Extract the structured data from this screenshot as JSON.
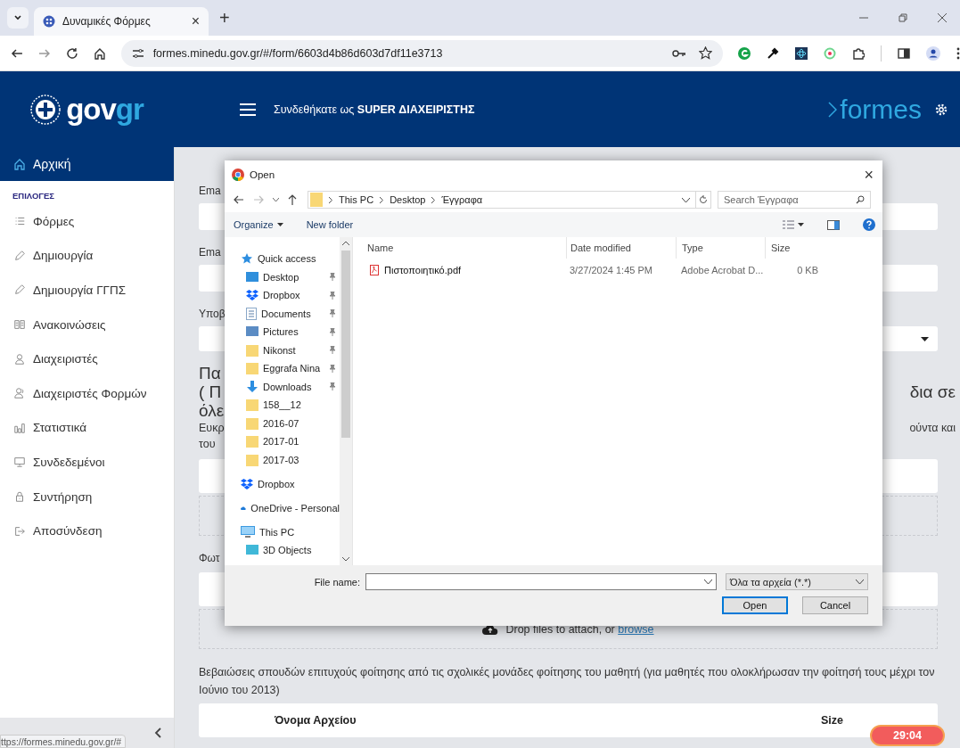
{
  "browser": {
    "tab": {
      "title": "Δυναμικές Φόρμες",
      "close": "×"
    },
    "new_tab": "+",
    "url": "formes.minedu.gov.gr/#/form/6603d4b86d603d7df11e3713",
    "status_url": "ttps://formes.minedu.gov.gr/#"
  },
  "header": {
    "logo": {
      "part_1": "gov",
      "part_2": "gr"
    },
    "login_text": "Συνδεθήκατε ως **SUPER ΔΙΑΧΕΙΡΙΣΤΗΣ**",
    "brand": "formes"
  },
  "sidebar": {
    "home": {
      "label": "Αρχική",
      "selected": true
    },
    "section": "ΕΠΙΛΟΓΕΣ",
    "items": [
      {
        "label": "Φόρμες",
        "selected": false
      },
      {
        "label": "Δημιουργία",
        "selected": false
      },
      {
        "label": "Δημιουργία ΓΓΠΣ",
        "selected": false
      },
      {
        "label": "Ανακοινώσεις",
        "selected": false
      },
      {
        "label": "Διαχειριστές",
        "selected": false
      },
      {
        "label": "Διαχειριστές Φορμών",
        "selected": false
      },
      {
        "label": "Στατιστικά",
        "selected": false
      },
      {
        "label": "Συνδεδεμένοι",
        "selected": false
      },
      {
        "label": "Συντήρηση",
        "selected": false
      },
      {
        "label": "Αποσύνδεση",
        "selected": false
      }
    ]
  },
  "form_rows": [
    {
      "kind": "label",
      "lines": [
        {
          "left": "Ema"
        }
      ]
    },
    {
      "kind": "field"
    },
    {
      "kind": "label",
      "lines": [
        {
          "left": "Ema"
        }
      ]
    },
    {
      "kind": "field"
    },
    {
      "kind": "label",
      "lines": [
        {
          "left": "Υποβ"
        }
      ]
    },
    {
      "kind": "select"
    },
    {
      "kind": "heading",
      "lines": [
        {
          "left": "Πα"
        },
        {
          "left": "( Π",
          "right": "δια σε"
        },
        {
          "left": "όλε"
        }
      ]
    },
    {
      "kind": "text",
      "lines": [
        {
          "left": "Ευκρ",
          "right": "ούντα και"
        },
        {
          "left": "του"
        }
      ]
    },
    {
      "kind": "file_list"
    },
    {
      "kind": "dropzone"
    },
    {
      "kind": "label",
      "lines": [
        {
          "left": "Φωτ"
        }
      ]
    },
    {
      "kind": "file_list"
    },
    {
      "kind": "dropzone",
      "text": "Drop files to attach, or",
      "link": "browse"
    },
    {
      "kind": "paragraph",
      "text": "Βεβαιώσεις σπουδών επιτυχούς φοίτησης από τις σχολικές μονάδες φοίτησης του μαθητή (για μαθητές που ολοκλήρωσαν την φοίτησή τους μέχρι τον Ιούνιο του 2013)"
    },
    {
      "kind": "table_header",
      "columns": [
        "Όνομα Αρχείου",
        "Size"
      ]
    }
  ],
  "timer": "29:04",
  "dialog": {
    "title": "Open",
    "close": "×",
    "breadcrumb": [
      "This PC",
      "Desktop",
      "Έγγραφα"
    ],
    "search": {
      "placeholder": "Search Έγγραφα"
    },
    "toolbar": {
      "organize": "Organize",
      "new_folder": "New folder"
    },
    "nav_pane": [
      {
        "label": "Quick access",
        "kind": "quick",
        "children": [
          {
            "label": "Desktop",
            "kind": "desktop",
            "pinned": true
          },
          {
            "label": "Dropbox",
            "kind": "dropbox",
            "pinned": true
          },
          {
            "label": "Documents",
            "kind": "documents",
            "pinned": true
          },
          {
            "label": "Pictures",
            "kind": "pictures",
            "pinned": true
          },
          {
            "label": "Nikonst",
            "kind": "folder",
            "pinned": true
          },
          {
            "label": "Eggrafa Nina",
            "kind": "folder",
            "pinned": true
          },
          {
            "label": "Downloads",
            "kind": "downloads",
            "pinned": true
          },
          {
            "label": "158__12",
            "kind": "folder",
            "pinned": false
          },
          {
            "label": "2016-07",
            "kind": "folder",
            "pinned": false
          },
          {
            "label": "2017-01",
            "kind": "folder",
            "pinned": false
          },
          {
            "label": "2017-03",
            "kind": "folder",
            "pinned": false
          }
        ]
      },
      {
        "label": "Dropbox",
        "kind": "dropbox"
      },
      {
        "label": "OneDrive - Personal",
        "kind": "onedrive"
      },
      {
        "label": "This PC",
        "kind": "pc",
        "children": [
          {
            "label": "3D Objects",
            "kind": "objects",
            "pinned": false
          }
        ]
      }
    ],
    "columns": [
      "Name",
      "Date modified",
      "Type",
      "Size"
    ],
    "files": [
      {
        "name": "Πιστοποιητικό.pdf",
        "date": "3/27/2024 1:45 PM",
        "type": "Adobe Acrobat D...",
        "size": "0 KB"
      }
    ],
    "file_name_label": "File name:",
    "filter": "Όλα τα αρχεία (*.*)",
    "open": "Open",
    "cancel": "Cancel"
  }
}
